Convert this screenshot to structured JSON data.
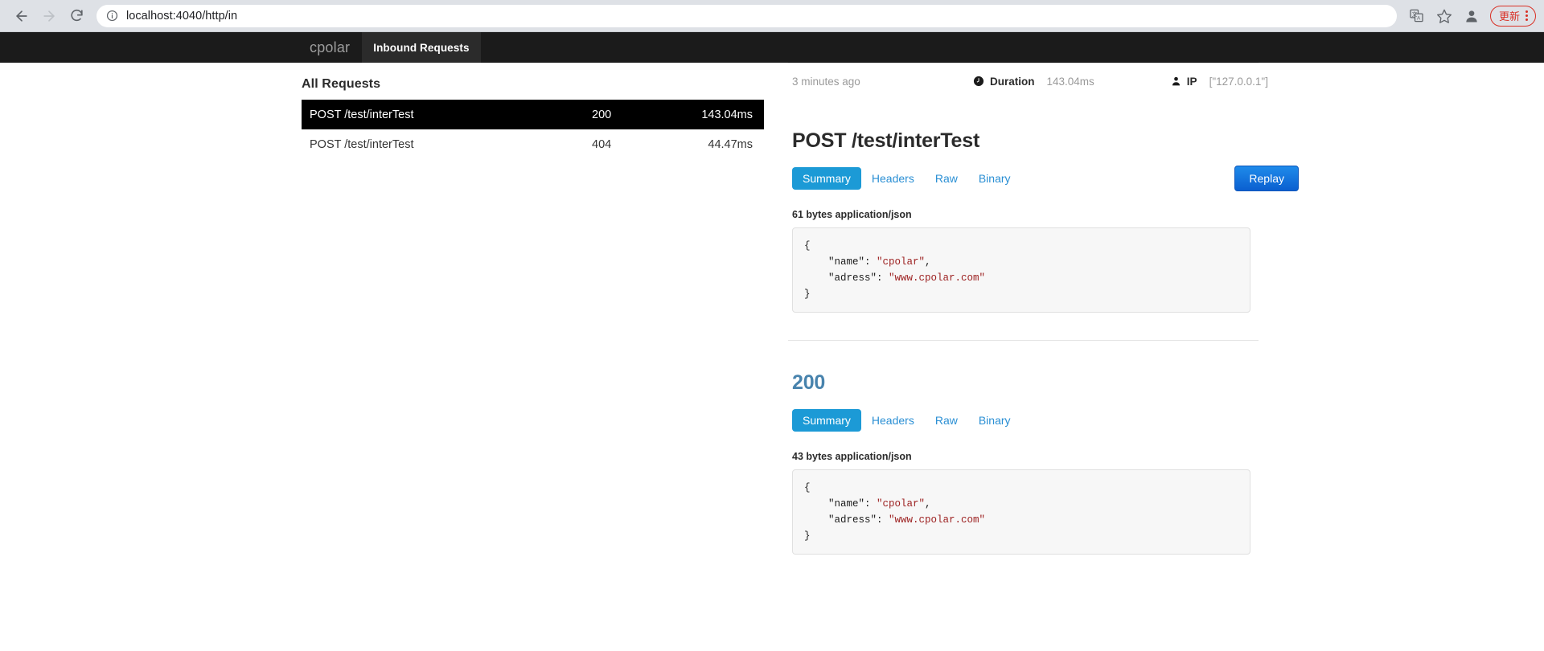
{
  "browser": {
    "url": "localhost:4040/http/in",
    "back_label": "Back",
    "forward_label": "Forward",
    "reload_label": "Reload",
    "site_info_label": "Site information",
    "translate_label": "Translate this page",
    "bookmark_label": "Bookmark this tab",
    "profile_label": "Profile",
    "update_label": "更新",
    "menu_label": "Customize and control"
  },
  "app": {
    "brand": "cpolar",
    "tab_inbound": "Inbound Requests"
  },
  "left": {
    "title": "All Requests",
    "requests": [
      {
        "path": "POST /test/interTest",
        "status": "200",
        "duration": "143.04ms",
        "selected": true
      },
      {
        "path": "POST /test/interTest",
        "status": "404",
        "duration": "44.47ms",
        "selected": false
      }
    ]
  },
  "detail": {
    "time_ago": "3 minutes ago",
    "duration_label": "Duration",
    "duration_value": "143.04ms",
    "ip_label": "IP",
    "ip_value": "[\"127.0.0.1\"]",
    "request": {
      "title": "POST /test/interTest",
      "tabs": [
        "Summary",
        "Headers",
        "Raw",
        "Binary"
      ],
      "active_tab": "Summary",
      "replay_label": "Replay",
      "bytes_label": "61 bytes application/json",
      "body_lines": [
        {
          "text": "{"
        },
        {
          "indent": 1,
          "key": "\"name\"",
          "sep": ": ",
          "value": "\"cpolar\"",
          "tail": ","
        },
        {
          "indent": 1,
          "key": "\"adress\"",
          "sep": ": ",
          "value": "\"www.cpolar.com\"",
          "tail": ""
        },
        {
          "text": "}"
        }
      ]
    },
    "response": {
      "title": "200",
      "tabs": [
        "Summary",
        "Headers",
        "Raw",
        "Binary"
      ],
      "active_tab": "Summary",
      "bytes_label": "43 bytes application/json",
      "body_lines": [
        {
          "text": "{"
        },
        {
          "indent": 1,
          "key": "\"name\"",
          "sep": ": ",
          "value": "\"cpolar\"",
          "tail": ","
        },
        {
          "indent": 1,
          "key": "\"adress\"",
          "sep": ": ",
          "value": "\"www.cpolar.com\"",
          "tail": ""
        },
        {
          "text": "}"
        }
      ]
    }
  },
  "colors": {
    "navbar_bg": "#1b1b1b",
    "tab_active": "#1c9ad6",
    "link_blue": "#2a8fd4",
    "replay_blue": "#0a5fd0",
    "status_blue": "#4883ad",
    "json_string": "#9c1f1f",
    "update_red": "#d93025"
  }
}
